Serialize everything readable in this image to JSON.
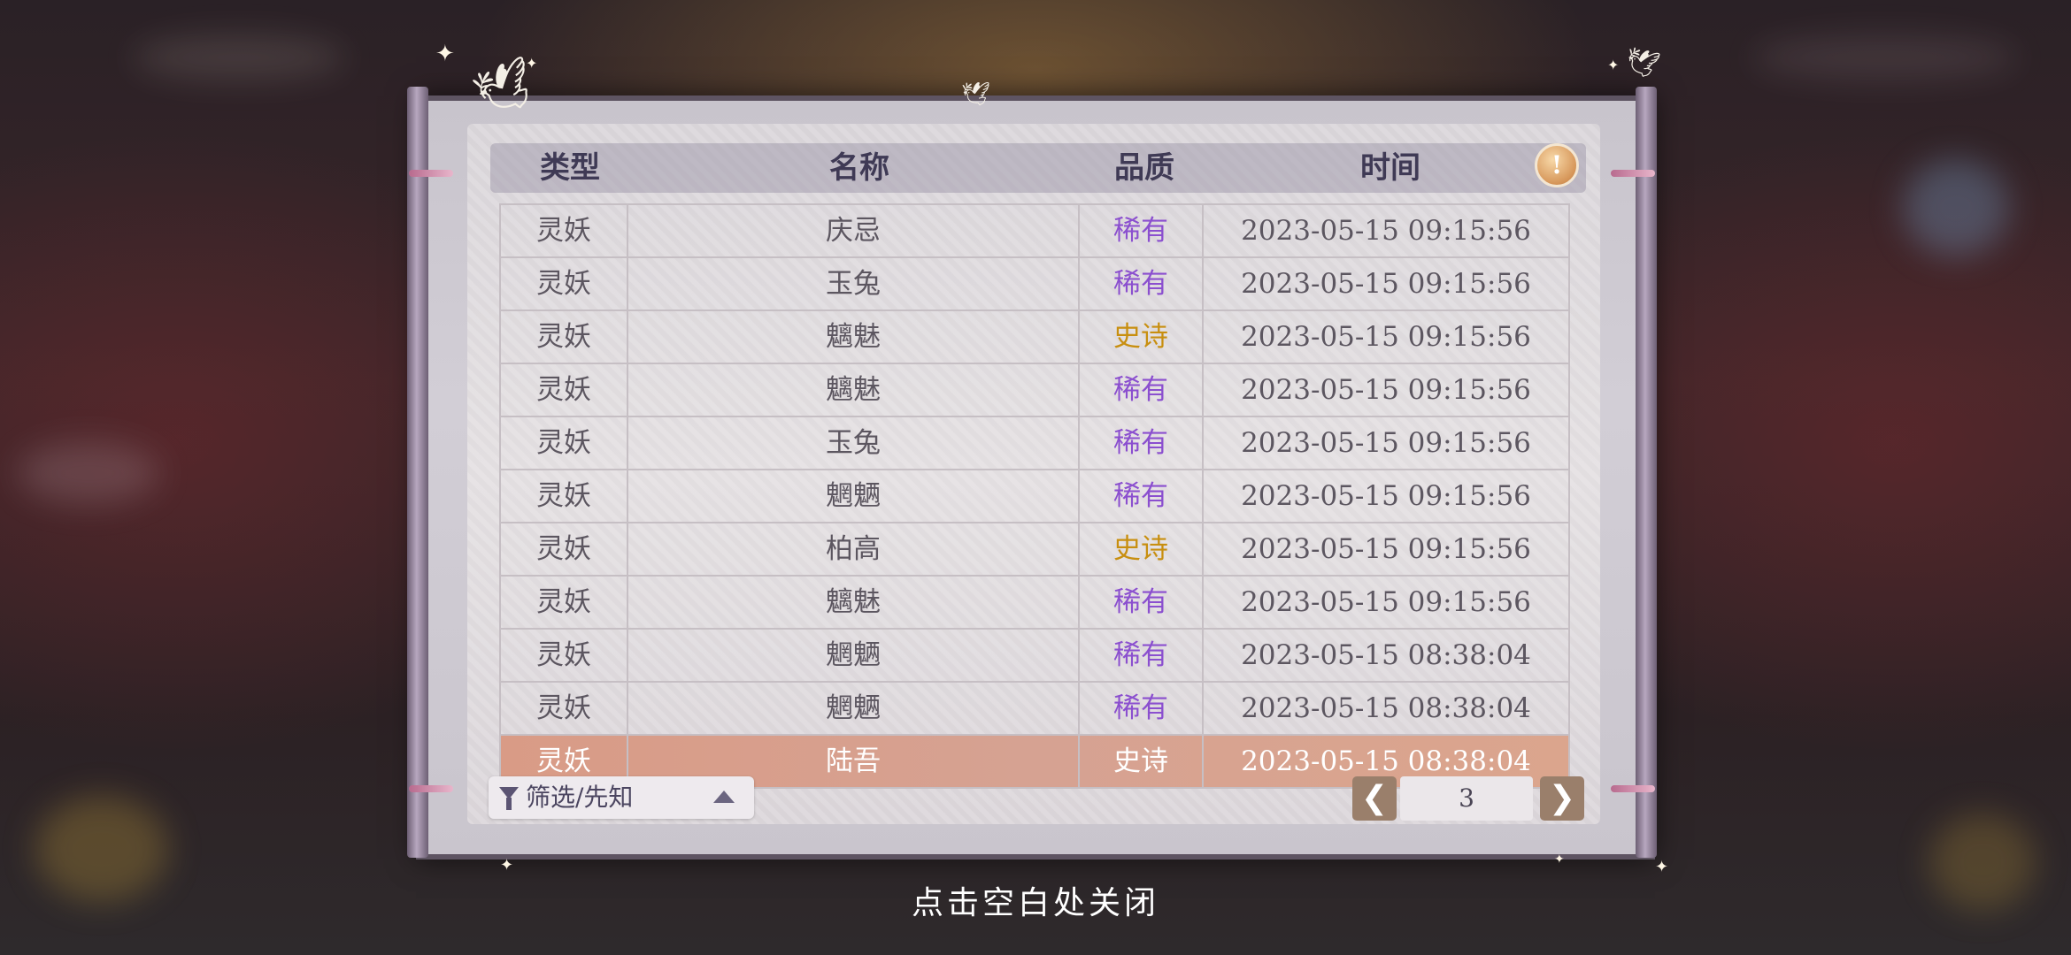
{
  "header": {
    "col_type": "类型",
    "col_name": "名称",
    "col_quality": "品质",
    "col_time": "时间"
  },
  "rows": [
    {
      "type": "灵妖",
      "name": "庆忌",
      "quality": "稀有",
      "time": "2023-05-15  09:15:56"
    },
    {
      "type": "灵妖",
      "name": "玉兔",
      "quality": "稀有",
      "time": "2023-05-15  09:15:56"
    },
    {
      "type": "灵妖",
      "name": "魑魅",
      "quality": "史诗",
      "time": "2023-05-15  09:15:56"
    },
    {
      "type": "灵妖",
      "name": "魑魅",
      "quality": "稀有",
      "time": "2023-05-15  09:15:56"
    },
    {
      "type": "灵妖",
      "name": "玉兔",
      "quality": "稀有",
      "time": "2023-05-15  09:15:56"
    },
    {
      "type": "灵妖",
      "name": "魍魉",
      "quality": "稀有",
      "time": "2023-05-15  09:15:56"
    },
    {
      "type": "灵妖",
      "name": "柏高",
      "quality": "史诗",
      "time": "2023-05-15  09:15:56"
    },
    {
      "type": "灵妖",
      "name": "魑魅",
      "quality": "稀有",
      "time": "2023-05-15  09:15:56"
    },
    {
      "type": "灵妖",
      "name": "魍魉",
      "quality": "稀有",
      "time": "2023-05-15  08:38:04"
    },
    {
      "type": "灵妖",
      "name": "魍魉",
      "quality": "稀有",
      "time": "2023-05-15  08:38:04"
    },
    {
      "type": "灵妖",
      "name": "陆吾",
      "quality": "史诗",
      "time": "2023-05-15  08:38:04"
    }
  ],
  "filter": {
    "label": "筛选/先知"
  },
  "pager": {
    "prev": "❮",
    "page": "3",
    "next": "❯"
  },
  "info_button": {
    "glyph": "!"
  },
  "close_hint": "点击空白处关闭",
  "colors": {
    "rare": "#8b4fcf",
    "epic": "#c88f10",
    "highlight_row": "#d99b86",
    "pager_button": "#9a7f6b"
  },
  "icons": [
    "filter-icon",
    "chevron-up-icon",
    "chevron-left-icon",
    "chevron-right-icon",
    "info-icon",
    "swallow-bird-icon",
    "sparkle-icon"
  ]
}
